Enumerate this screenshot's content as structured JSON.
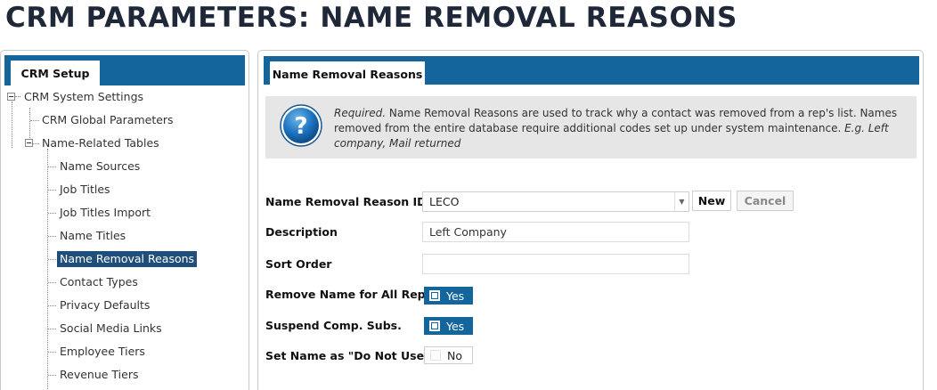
{
  "page": {
    "title": "CRM PARAMETERS: NAME REMOVAL REASONS"
  },
  "left": {
    "tab_label": "CRM Setup",
    "tree": {
      "root": "CRM System Settings",
      "global": "CRM Global Parameters",
      "group": "Name-Related Tables",
      "items": [
        "Name Sources",
        "Job Titles",
        "Job Titles Import",
        "Name Titles",
        "Name Removal Reasons",
        "Contact Types",
        "Privacy Defaults",
        "Social Media Links",
        "Employee Tiers",
        "Revenue Tiers"
      ],
      "selected_index": 4
    }
  },
  "right": {
    "tab_label": "Name Removal Reasons",
    "info": {
      "lead": "Required.",
      "body": " Name Removal Reasons are used to track why a contact was removed from a rep's list. Names removed from the entire database require additional codes set up under system maintenance. ",
      "example": "E.g. Left company, Mail returned"
    },
    "form": {
      "id_label": "Name Removal Reason ID",
      "id_value": "LECO",
      "new_label": "New",
      "cancel_label": "Cancel",
      "description_label": "Description",
      "description_value": "Left Company",
      "sort_label": "Sort Order",
      "sort_value": "",
      "remove_all_label": "Remove Name for All Reps",
      "remove_all_value": "Yes",
      "suspend_label": "Suspend Comp. Subs.",
      "suspend_value": "Yes",
      "do_not_use_label": "Set Name as \"Do Not Use\"",
      "do_not_use_value": "No"
    }
  },
  "colors": {
    "accent": "#13659c",
    "selected": "#1e4e79",
    "info_bg": "#e6e6e6"
  },
  "icons": {
    "info": "question-mark-icon",
    "expander": "collapse-icon",
    "dropdown": "chevron-down-icon"
  }
}
